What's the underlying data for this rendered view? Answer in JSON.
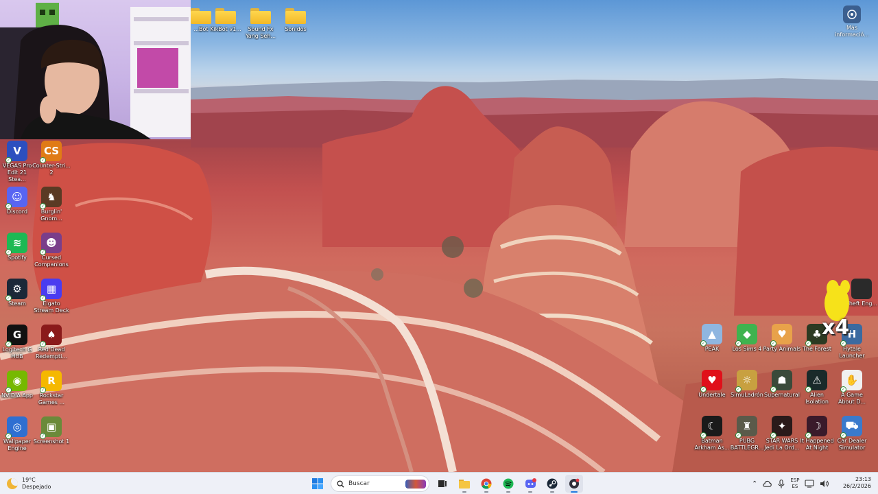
{
  "webcam": {
    "alt": "streamer webcam overlay"
  },
  "top_folders": [
    {
      "label": "...Bot"
    },
    {
      "label": "KikBot v1..."
    },
    {
      "label": "Sound Fx Yang Seh..."
    },
    {
      "label": "Sonidos"
    }
  ],
  "info_button": {
    "label": "Más informació..."
  },
  "left_icons": [
    {
      "label": "VEGAS Pro Edit 21 Stea...",
      "glyph": "V",
      "color": "#2c4fbf"
    },
    {
      "label": "Counter-Stri... 2",
      "glyph": "CS",
      "color": "#e07b16"
    },
    {
      "label": "Discord",
      "glyph": "☺",
      "color": "#5865f2"
    },
    {
      "label": "Burglin' Gnom...",
      "glyph": "♞",
      "color": "#5a3a24"
    },
    {
      "label": "Spotify",
      "glyph": "≋",
      "color": "#1db954"
    },
    {
      "label": "Cursed Companions",
      "glyph": "☻",
      "color": "#7a3e8a"
    },
    {
      "label": "Steam",
      "glyph": "⚙",
      "color": "#1b2838"
    },
    {
      "label": "Elgato Stream Deck",
      "glyph": "▦",
      "color": "#4a3cf0"
    },
    {
      "label": "Logitech G HUB",
      "glyph": "G",
      "color": "#111111"
    },
    {
      "label": "Red Dead Redempti...",
      "glyph": "♠",
      "color": "#8a1a1a"
    },
    {
      "label": "NVIDIA App",
      "glyph": "◉",
      "color": "#76b900"
    },
    {
      "label": "Rockstar Games ...",
      "glyph": "R",
      "color": "#f5b800"
    },
    {
      "label": "Wallpaper Engine",
      "glyph": "◎",
      "color": "#2f6fd1"
    },
    {
      "label": "Screenshot 1",
      "glyph": "▣",
      "color": "#6a8a3a"
    }
  ],
  "right_icons": [
    {
      "label": "PEAK",
      "glyph": "▲",
      "color": "#8fb6e0"
    },
    {
      "label": "Los Sims 4",
      "glyph": "◆",
      "color": "#3fb34f"
    },
    {
      "label": "Party Animals",
      "glyph": "♥",
      "color": "#e8a24a"
    },
    {
      "label": "The Forest",
      "glyph": "♣",
      "color": "#2c3a22"
    },
    {
      "label": "Hytale Launcher",
      "glyph": "H",
      "color": "#3a6aa0"
    },
    {
      "label": "Undertale",
      "glyph": "♥",
      "color": "#e0101a"
    },
    {
      "label": "SimuLadrón",
      "glyph": "☼",
      "color": "#c8a040"
    },
    {
      "label": "Supernatural",
      "glyph": "☗",
      "color": "#3a4a3a"
    },
    {
      "label": "Alien Isolation",
      "glyph": "⚠",
      "color": "#1a2a2a"
    },
    {
      "label": "A Game About D...",
      "glyph": "✋",
      "color": "#f0f0f0"
    },
    {
      "label": "Batman Arkham As...",
      "glyph": "☾",
      "color": "#1a1a1a"
    },
    {
      "label": "PUBG BATTLEGR...",
      "glyph": "♜",
      "color": "#5a5a4a"
    },
    {
      "label": "STAR WARS Jedi La Ord...",
      "glyph": "✦",
      "color": "#2a1a1a"
    },
    {
      "label": "It Happened At Night",
      "glyph": "☽",
      "color": "#3a1a2a"
    },
    {
      "label": "Car Dealer Simulator",
      "glyph": "⛟",
      "color": "#3a7acc"
    }
  ],
  "partial_icon": {
    "label": "Theft Eng..."
  },
  "mascot": {
    "text": "x4"
  },
  "taskbar": {
    "weather_temp": "19°C",
    "weather_desc": "Despejado",
    "search_placeholder": "Buscar",
    "lang_top": "ESP",
    "lang_bottom": "ES",
    "time": "23:13",
    "date": "26/2/2026"
  }
}
